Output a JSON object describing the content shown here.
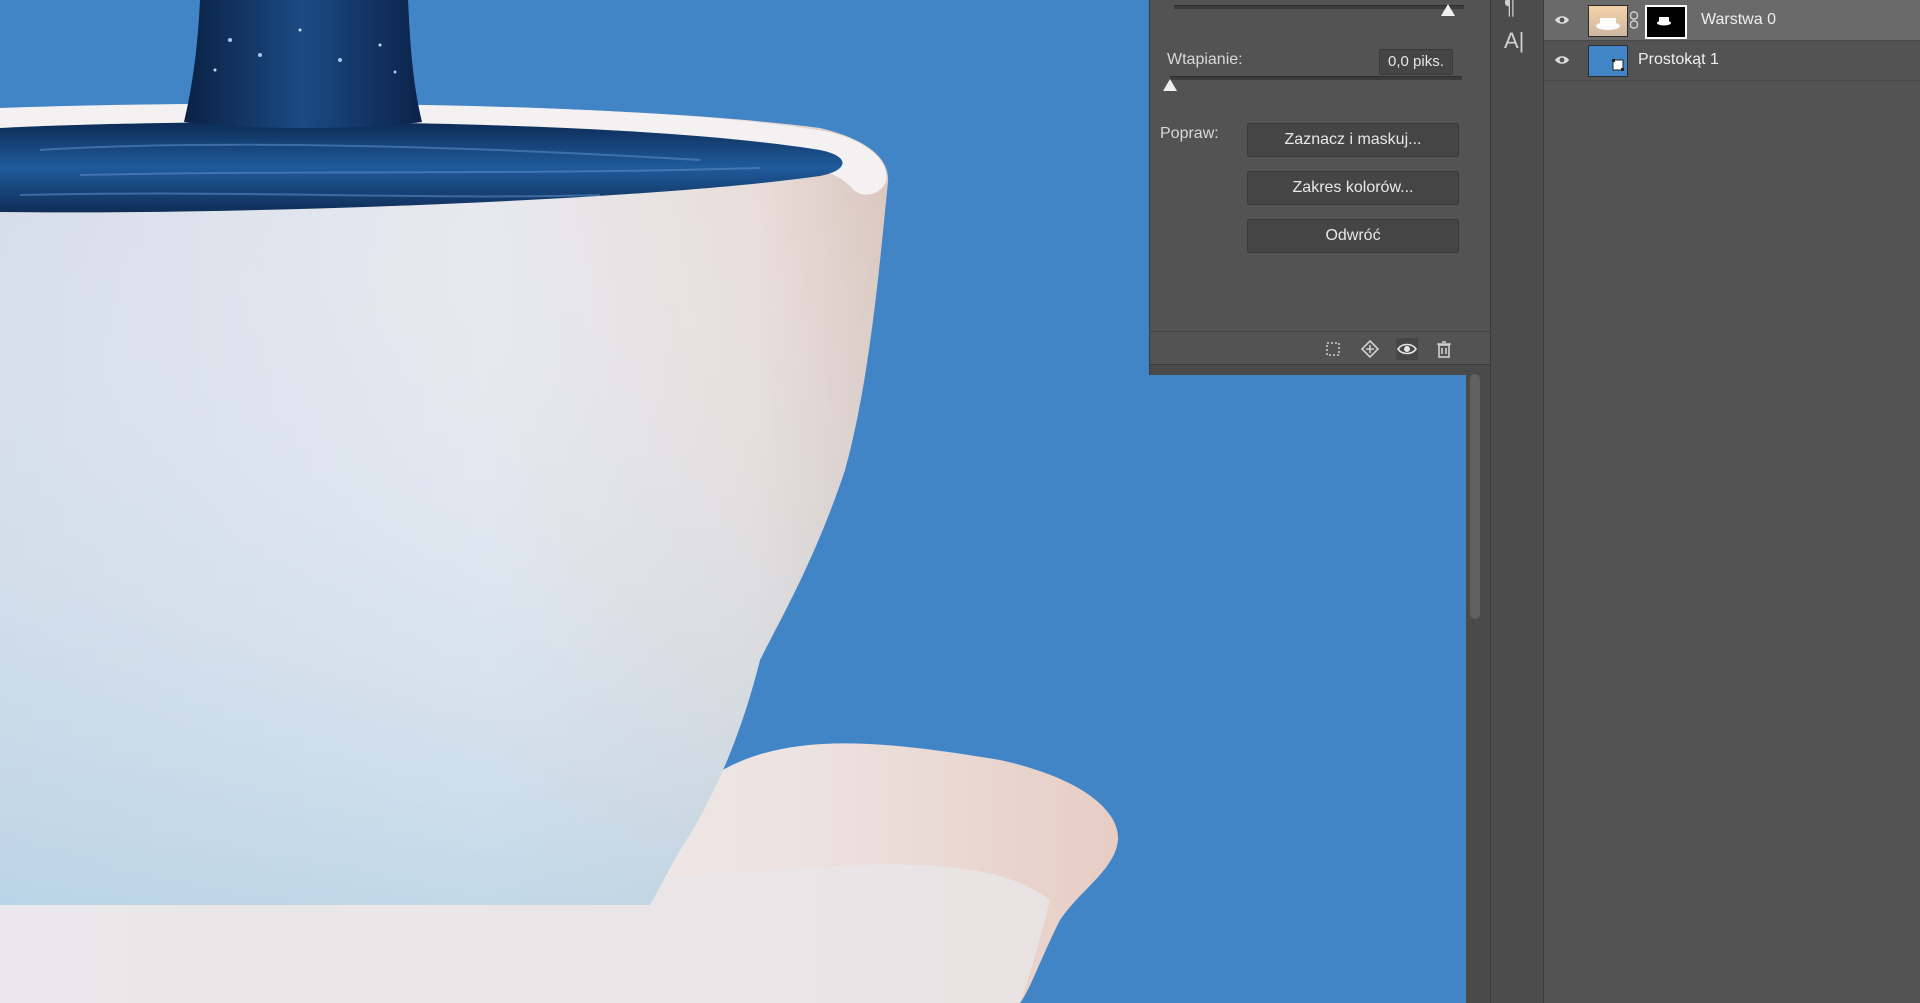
{
  "properties": {
    "feather_label": "Wtapianie:",
    "feather_value": "0,0 piks.",
    "refine_label": "Popraw:",
    "buttons": {
      "select_and_mask": "Zaznacz i maskuj...",
      "color_range": "Zakres kolorów...",
      "invert": "Odwróć"
    },
    "footer_icons": [
      "selection-icon",
      "apply-mask-icon",
      "visibility-icon",
      "trash-icon"
    ]
  },
  "toolstrip": {
    "icons": [
      "paragraph-icon",
      "character-icon"
    ]
  },
  "layers": {
    "items": [
      {
        "name": "Warstwa 0",
        "selected": true,
        "has_mask": true
      },
      {
        "name": "Prostokąt 1",
        "selected": false,
        "has_mask": false
      }
    ]
  },
  "colors": {
    "canvas_background": "#4285c6",
    "panel": "#535353",
    "selected_row": "#6a6a6a"
  }
}
